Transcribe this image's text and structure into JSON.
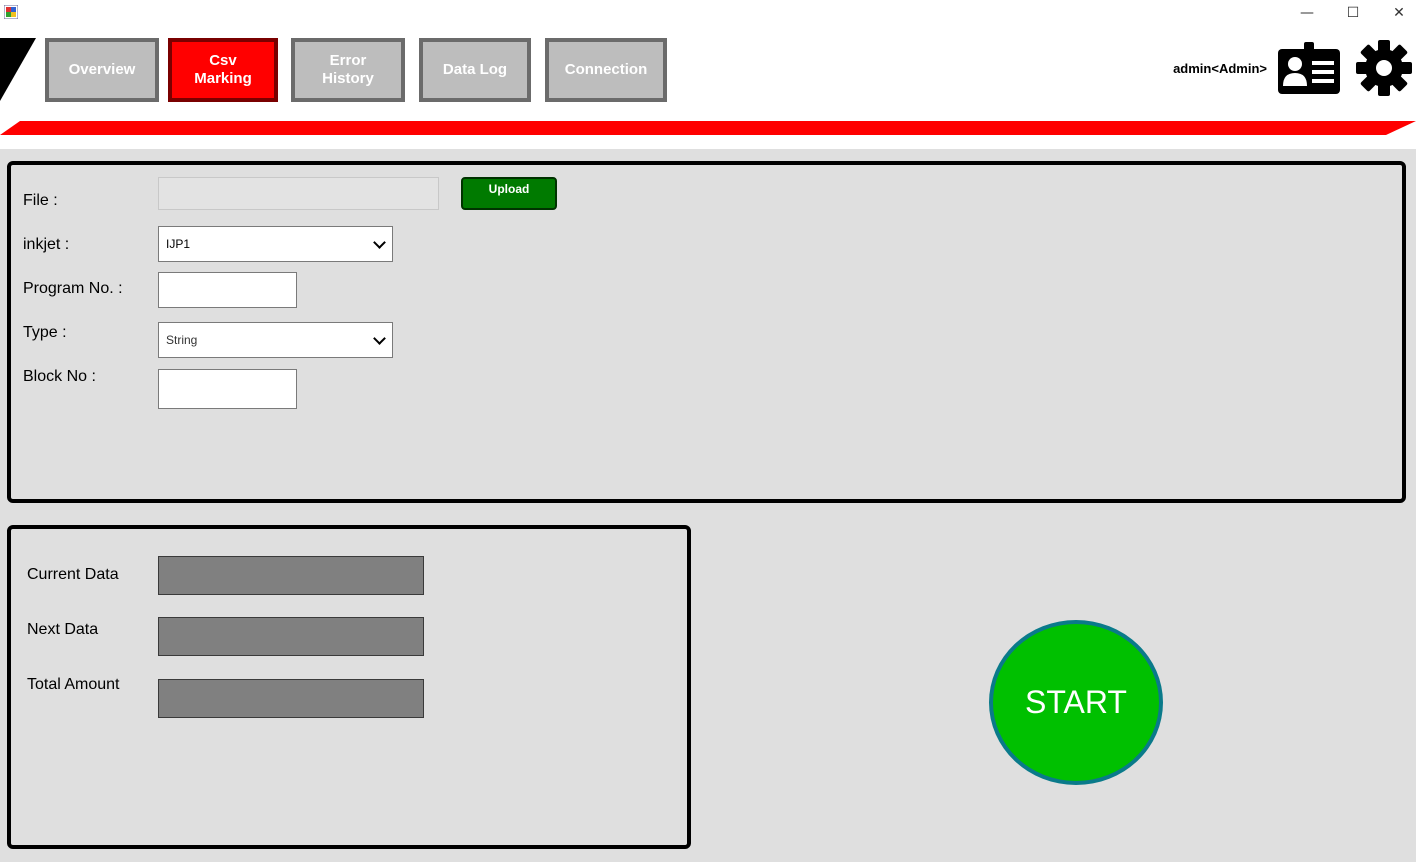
{
  "window": {
    "minimize_glyph": "—",
    "maximize_glyph": "☐",
    "close_glyph": "✕"
  },
  "nav": {
    "tabs": [
      {
        "label": "Overview",
        "active": false
      },
      {
        "label": "Csv\nMarking",
        "active": true
      },
      {
        "label": "Error\nHistory",
        "active": false
      },
      {
        "label": "Data Log",
        "active": false
      },
      {
        "label": "Connection",
        "active": false
      }
    ]
  },
  "user": {
    "label": "admin<Admin>",
    "icon": "user-id-card-icon"
  },
  "settings": {
    "icon": "gear-icon"
  },
  "form": {
    "file_label": "File :",
    "file_value": "",
    "upload_label": "Upload",
    "inkjet_label": "inkjet :",
    "inkjet_value": "IJP1",
    "program_label": "Program No. :",
    "program_value": "",
    "type_label": "Type :",
    "type_value": "String",
    "block_label": "Block No :",
    "block_value": ""
  },
  "status": {
    "current_label": "Current Data",
    "current_value": "",
    "next_label": "Next Data",
    "next_value": "",
    "total_label": "Total Amount",
    "total_value": ""
  },
  "start_label": "START",
  "colors": {
    "accent_red": "#ff0000",
    "tab_gray": "#bdbdbd",
    "upload_green": "#007a00",
    "start_green": "#00c000",
    "start_border": "#0a7a8a"
  }
}
